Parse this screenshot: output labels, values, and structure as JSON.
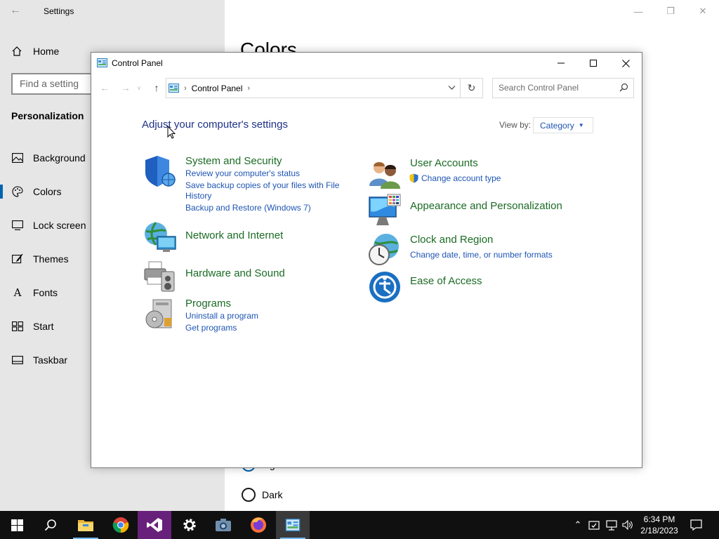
{
  "settings": {
    "app_title": "Settings",
    "home_label": "Home",
    "search_placeholder": "Find a setting",
    "section_label": "Personalization",
    "nav_items": [
      {
        "label": "Background",
        "icon": "picture-icon"
      },
      {
        "label": "Colors",
        "icon": "palette-icon",
        "active": true
      },
      {
        "label": "Lock screen",
        "icon": "lock-screen-icon"
      },
      {
        "label": "Themes",
        "icon": "brush-icon"
      },
      {
        "label": "Fonts",
        "icon": "font-icon"
      },
      {
        "label": "Start",
        "icon": "start-icon"
      },
      {
        "label": "Taskbar",
        "icon": "taskbar-icon"
      }
    ],
    "page_heading": "Colors",
    "radio_light_label": "Light",
    "radio_dark_label": "Dark"
  },
  "control_panel": {
    "window_title": "Control Panel",
    "breadcrumb": [
      "Control Panel"
    ],
    "search_placeholder": "Search Control Panel",
    "heading": "Adjust your computer's settings",
    "view_by_label": "View by:",
    "view_by_value": "Category",
    "categories": [
      {
        "title": "System and Security",
        "links": [
          "Review your computer's status",
          "Save backup copies of your files with File",
          "History",
          "Backup and Restore (Windows 7)"
        ]
      },
      {
        "title": "Network and Internet",
        "links": []
      },
      {
        "title": "Hardware and Sound",
        "links": []
      },
      {
        "title": "Programs",
        "links": [
          "Uninstall a program",
          "Get programs"
        ]
      },
      {
        "title": "User Accounts",
        "links": [
          "Change account type"
        ]
      },
      {
        "title": "Appearance and Personalization",
        "links": []
      },
      {
        "title": "Clock and Region",
        "links": [
          "Change date, time, or number formats"
        ]
      },
      {
        "title": "Ease of Access",
        "links": []
      }
    ]
  },
  "taskbar": {
    "apps": [
      "start-icon",
      "search-icon",
      "file-explorer-icon",
      "chrome-icon",
      "visual-studio-icon",
      "settings-gear-icon",
      "camera-icon",
      "firefox-icon",
      "control-panel-icon"
    ],
    "clock_time": "6:34 PM",
    "clock_date": "2/18/2023"
  },
  "colors": {
    "link_blue": "#1e55b3",
    "category_green": "#1b6b24",
    "heading_blue": "#1e3287",
    "accent": "#0063b1"
  }
}
